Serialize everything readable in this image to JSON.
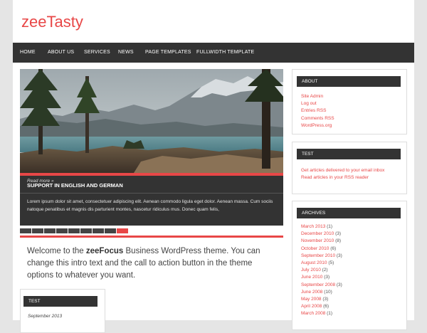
{
  "site": {
    "title": "zeeTasty"
  },
  "nav": {
    "items": [
      {
        "label": "HOME"
      },
      {
        "label": "ABOUT US"
      },
      {
        "label": "SERVICES"
      },
      {
        "label": "NEWS"
      },
      {
        "label": "PAGE TEMPLATES"
      },
      {
        "label": "FULLWIDTH TEMPLATE"
      }
    ]
  },
  "slider": {
    "caption_title": "SUPPORT IN ENGLISH AND GERMAN",
    "caption_text": "Lorem ipsum dolor sit amet, consectetuer adipiscing elit. Aenean commodo ligula eget dolor. Aenean massa. Cum sociis natoque penatibus et magnis dis parturient montes, nascetur ridiculus mus. Donec quam felis,",
    "read_more": "Read more »",
    "pager_count": 9,
    "active_index": 8
  },
  "intro": {
    "before": "Welcome to the ",
    "bold": "zeeFocus",
    "after": " Business WordPress theme. You can change this intro text and the call to action button in the theme options to whatever you want."
  },
  "widget_left": {
    "title": "TEST",
    "date": "September 2013"
  },
  "sidebar": {
    "about": {
      "title": "ABOUT",
      "links": [
        "Site Admin",
        "Log out",
        "Entries RSS",
        "Comments RSS",
        "WordPress.org"
      ]
    },
    "test": {
      "title": "TEST",
      "links": [
        "Get articles delivered to your email inbox",
        "Read articles in your RSS reader"
      ]
    },
    "archives": {
      "title": "ARCHIVES",
      "items": [
        {
          "month": "March 2013",
          "count": "(1)"
        },
        {
          "month": "December 2010",
          "count": "(3)"
        },
        {
          "month": "November 2010",
          "count": "(8)"
        },
        {
          "month": "October 2010",
          "count": "(6)"
        },
        {
          "month": "September 2010",
          "count": "(3)"
        },
        {
          "month": "August 2010",
          "count": "(5)"
        },
        {
          "month": "July 2010",
          "count": "(2)"
        },
        {
          "month": "June 2010",
          "count": "(3)"
        },
        {
          "month": "September 2008",
          "count": "(3)"
        },
        {
          "month": "June 2008",
          "count": "(10)"
        },
        {
          "month": "May 2008",
          "count": "(3)"
        },
        {
          "month": "April 2008",
          "count": "(6)"
        },
        {
          "month": "March 2008",
          "count": "(1)"
        }
      ]
    }
  },
  "colors": {
    "accent": "#e84747",
    "dark": "#333333",
    "background": "#e5e5e5"
  }
}
